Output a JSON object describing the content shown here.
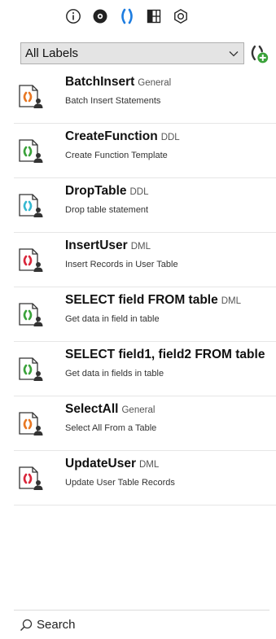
{
  "toolbar": {
    "icons": [
      "info-icon",
      "eye-icon",
      "snippet-braces-icon",
      "layout-grid-icon",
      "hexagon-settings-icon"
    ],
    "active_color": "#1e7de0"
  },
  "filter": {
    "selected": "All Labels"
  },
  "snippets": [
    {
      "name": "BatchInsert",
      "label": "General",
      "description": "Batch Insert Statements",
      "color": "#e87722"
    },
    {
      "name": "CreateFunction",
      "label": "DDL",
      "description": "Create Function Template",
      "color": "#3aa23a"
    },
    {
      "name": "DropTable",
      "label": "DDL",
      "description": "Drop table statement",
      "color": "#35b8d0"
    },
    {
      "name": "InsertUser",
      "label": "DML",
      "description": "Insert Records in User Table",
      "color": "#d9263a"
    },
    {
      "name": "SELECT field FROM table",
      "label": "DML",
      "description": "Get data in field in table",
      "color": "#3aa23a"
    },
    {
      "name": "SELECT field1, field2 FROM table",
      "label": "",
      "description": "Get data in fields in table",
      "color": "#3aa23a"
    },
    {
      "name": "SelectAll",
      "label": "General",
      "description": "Select All From a Table",
      "color": "#e87722"
    },
    {
      "name": "UpdateUser",
      "label": "DML",
      "description": "Update User Table Records",
      "color": "#d9263a"
    }
  ],
  "search": {
    "label": "Search"
  }
}
